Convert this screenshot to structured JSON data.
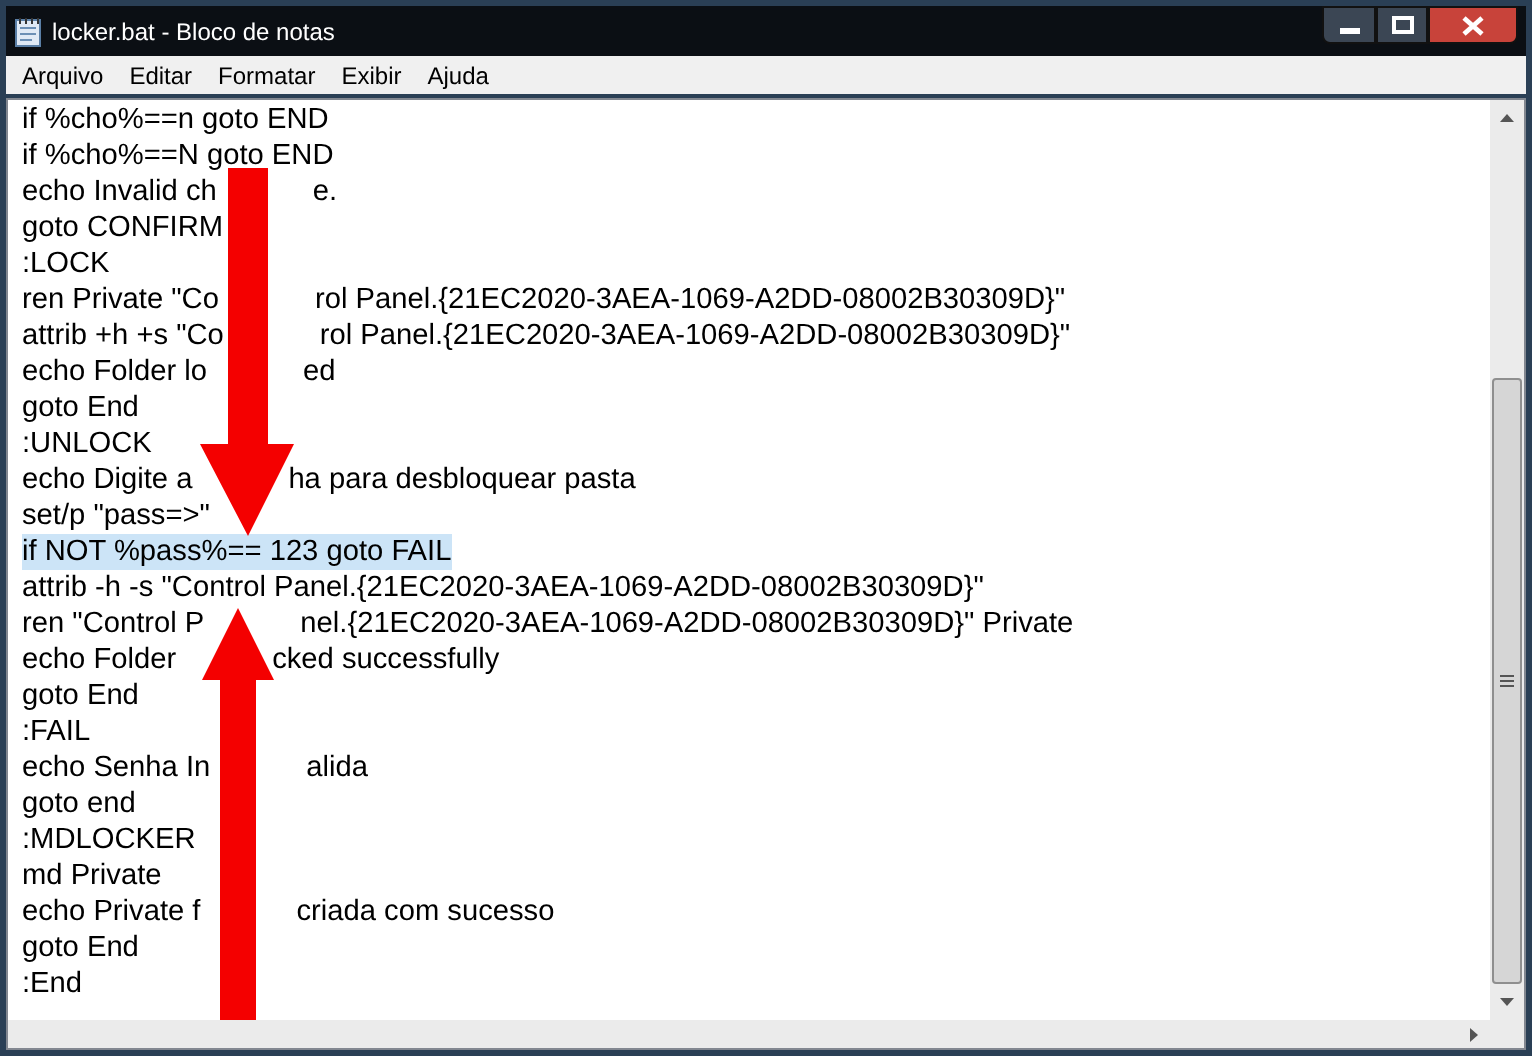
{
  "window": {
    "title": "locker.bat - Bloco de notas"
  },
  "menu": [
    "Arquivo",
    "Editar",
    "Formatar",
    "Exibir",
    "Ajuda"
  ],
  "lines": [
    {
      "parts": [
        "if %cho%==n goto END"
      ],
      "selected": false
    },
    {
      "parts": [
        "if %cho%==N goto END"
      ],
      "selected": false
    },
    {
      "parts": [
        "echo Invalid ch",
        "e."
      ],
      "selected": false
    },
    {
      "parts": [
        "goto CONFIRM"
      ],
      "selected": false
    },
    {
      "parts": [
        ":LOCK"
      ],
      "selected": false
    },
    {
      "parts": [
        "ren Private \"Co",
        "rol Panel.{21EC2020-3AEA-1069-A2DD-08002B30309D}\""
      ],
      "selected": false
    },
    {
      "parts": [
        "attrib +h +s \"Co",
        "rol Panel.{21EC2020-3AEA-1069-A2DD-08002B30309D}\""
      ],
      "selected": false
    },
    {
      "parts": [
        "echo Folder lo",
        "ed"
      ],
      "selected": false
    },
    {
      "parts": [
        "goto End"
      ],
      "selected": false
    },
    {
      "parts": [
        ":UNLOCK"
      ],
      "selected": false
    },
    {
      "parts": [
        "echo Digite a",
        "ha para desbloquear pasta"
      ],
      "selected": false
    },
    {
      "parts": [
        "set/p \"pass=>\""
      ],
      "selected": false
    },
    {
      "parts": [
        "if NOT %pass%== 123 goto FAIL"
      ],
      "selected": true
    },
    {
      "parts": [
        "attrib -h -s \"Control Panel.{21EC2020-3AEA-1069-A2DD-08002B30309D}\""
      ],
      "selected": false
    },
    {
      "parts": [
        "ren \"Control P",
        "nel.{21EC2020-3AEA-1069-A2DD-08002B30309D}\" Private"
      ],
      "selected": false
    },
    {
      "parts": [
        "echo Folder",
        "cked successfully"
      ],
      "selected": false
    },
    {
      "parts": [
        "goto End"
      ],
      "selected": false
    },
    {
      "parts": [
        ":FAIL"
      ],
      "selected": false
    },
    {
      "parts": [
        "echo Senha In",
        "alida"
      ],
      "selected": false
    },
    {
      "parts": [
        "goto end"
      ],
      "selected": false
    },
    {
      "parts": [
        ":MDLOCKER"
      ],
      "selected": false
    },
    {
      "parts": [
        "md Private"
      ],
      "selected": false
    },
    {
      "parts": [
        "echo Private f",
        "criada com sucesso"
      ],
      "selected": false
    },
    {
      "parts": [
        "goto End"
      ],
      "selected": false
    },
    {
      "parts": [
        ":End"
      ],
      "selected": false
    }
  ]
}
